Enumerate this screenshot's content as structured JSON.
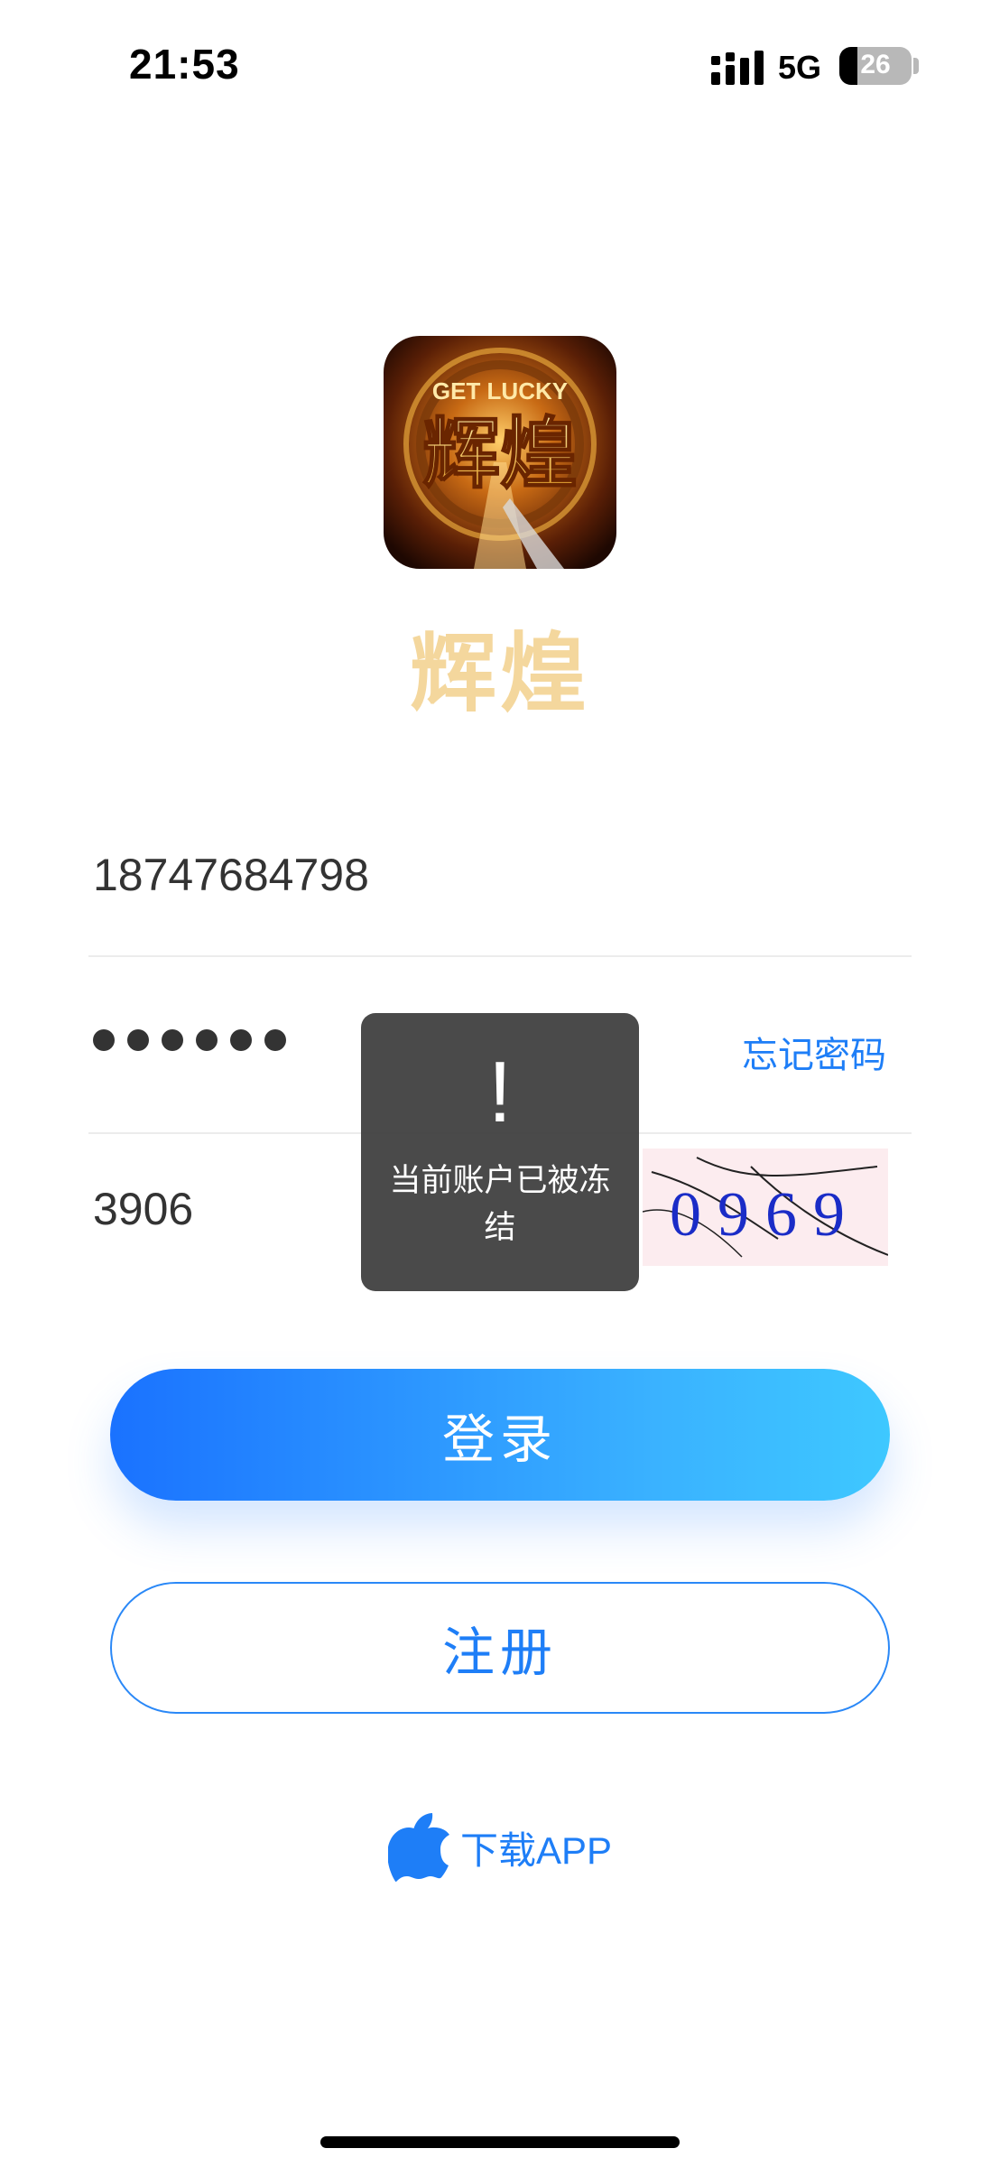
{
  "status_bar": {
    "time": "21:53",
    "network": "5G",
    "battery": "26"
  },
  "app": {
    "name": "辉煌",
    "logo_text": "辉煌",
    "logo_banner": "GET LUCKY"
  },
  "form": {
    "phone_value": "18747684798",
    "password_dots": 6,
    "forgot_password": "忘记密码",
    "captcha_value": "3906",
    "captcha_image_text": "0969"
  },
  "buttons": {
    "login": "登录",
    "register": "注册"
  },
  "download": {
    "label": "下载APP",
    "icon": "apple-icon"
  },
  "toast": {
    "icon": "!",
    "message": "当前账户已被冻结"
  },
  "colors": {
    "accent": "#1e7ef7",
    "brand_gold": "#f4d79d",
    "toast_bg": "#3c3c3c"
  }
}
